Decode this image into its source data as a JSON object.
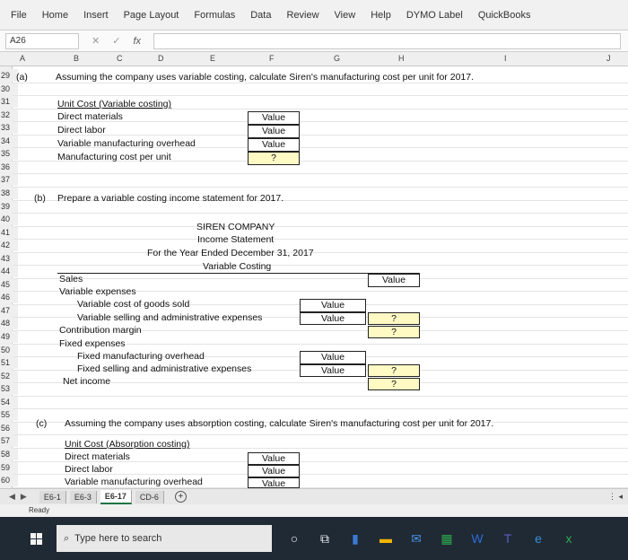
{
  "ribbon": {
    "tabs": [
      "File",
      "Home",
      "Insert",
      "Page Layout",
      "Formulas",
      "Data",
      "Review",
      "View",
      "Help",
      "DYMO Label",
      "QuickBooks"
    ]
  },
  "formula_bar": {
    "name_box": "A26",
    "fx": "fx",
    "cancel": "✕",
    "enter": "✓"
  },
  "columns": [
    "A",
    "B",
    "C",
    "D",
    "E",
    "F",
    "G",
    "H",
    "I",
    "J"
  ],
  "rows": [
    "29",
    "30",
    "31",
    "32",
    "33",
    "34",
    "35",
    "36",
    "37",
    "38",
    "39",
    "40",
    "41",
    "42",
    "43",
    "44",
    "45",
    "46",
    "47",
    "48",
    "49",
    "50",
    "51",
    "52",
    "53",
    "54",
    "55",
    "56",
    "57",
    "58",
    "59",
    "60"
  ],
  "part_a": {
    "label": "(a)",
    "prompt": "Assuming the company uses variable costing, calculate Siren's manufacturing cost per unit for 2017.",
    "heading": "Unit Cost (Variable costing)",
    "lines": [
      "Direct materials",
      "Direct labor",
      "Variable manufacturing overhead",
      "Manufacturing cost per unit"
    ],
    "values": [
      "Value",
      "Value",
      "Value",
      "?"
    ]
  },
  "part_b": {
    "label": "(b)",
    "prompt": "Prepare a variable costing income statement for 2017.",
    "company": "SIREN COMPANY",
    "statement": "Income Statement",
    "period": "For the Year Ended December 31, 2017",
    "method": "Variable Costing",
    "sales": "Sales",
    "sales_value": "Value",
    "var_exp": "Variable expenses",
    "var_cogs": "Variable cost of goods sold",
    "var_cogs_value": "Value",
    "var_sga": "Variable selling and administrative expenses",
    "var_sga_value": "Value",
    "var_total": "?",
    "contrib": "Contribution margin",
    "contrib_value": "?",
    "fixed_exp": "Fixed expenses",
    "fixed_moh": "Fixed manufacturing overhead",
    "fixed_moh_value": "Value",
    "fixed_sga": "Fixed selling and administrative expenses",
    "fixed_sga_value": "Value",
    "fixed_total": "?",
    "net_income": "Net income",
    "net_income_value": "?"
  },
  "part_c": {
    "label": "(c)",
    "prompt": "Assuming the company uses absorption costing, calculate Siren's manufacturing cost per unit for 2017.",
    "heading": "Unit Cost (Absorption costing)",
    "lines": [
      "Direct materials",
      "Direct labor",
      "Variable manufacturing overhead"
    ],
    "values": [
      "Value",
      "Value",
      "Value"
    ]
  },
  "sheet_tabs": [
    "E6-1",
    "E6-3",
    "E6-17",
    "CD-6"
  ],
  "active_tab": "E6-17",
  "status": "Ready",
  "taskbar": {
    "search_placeholder": "Type here to search"
  }
}
